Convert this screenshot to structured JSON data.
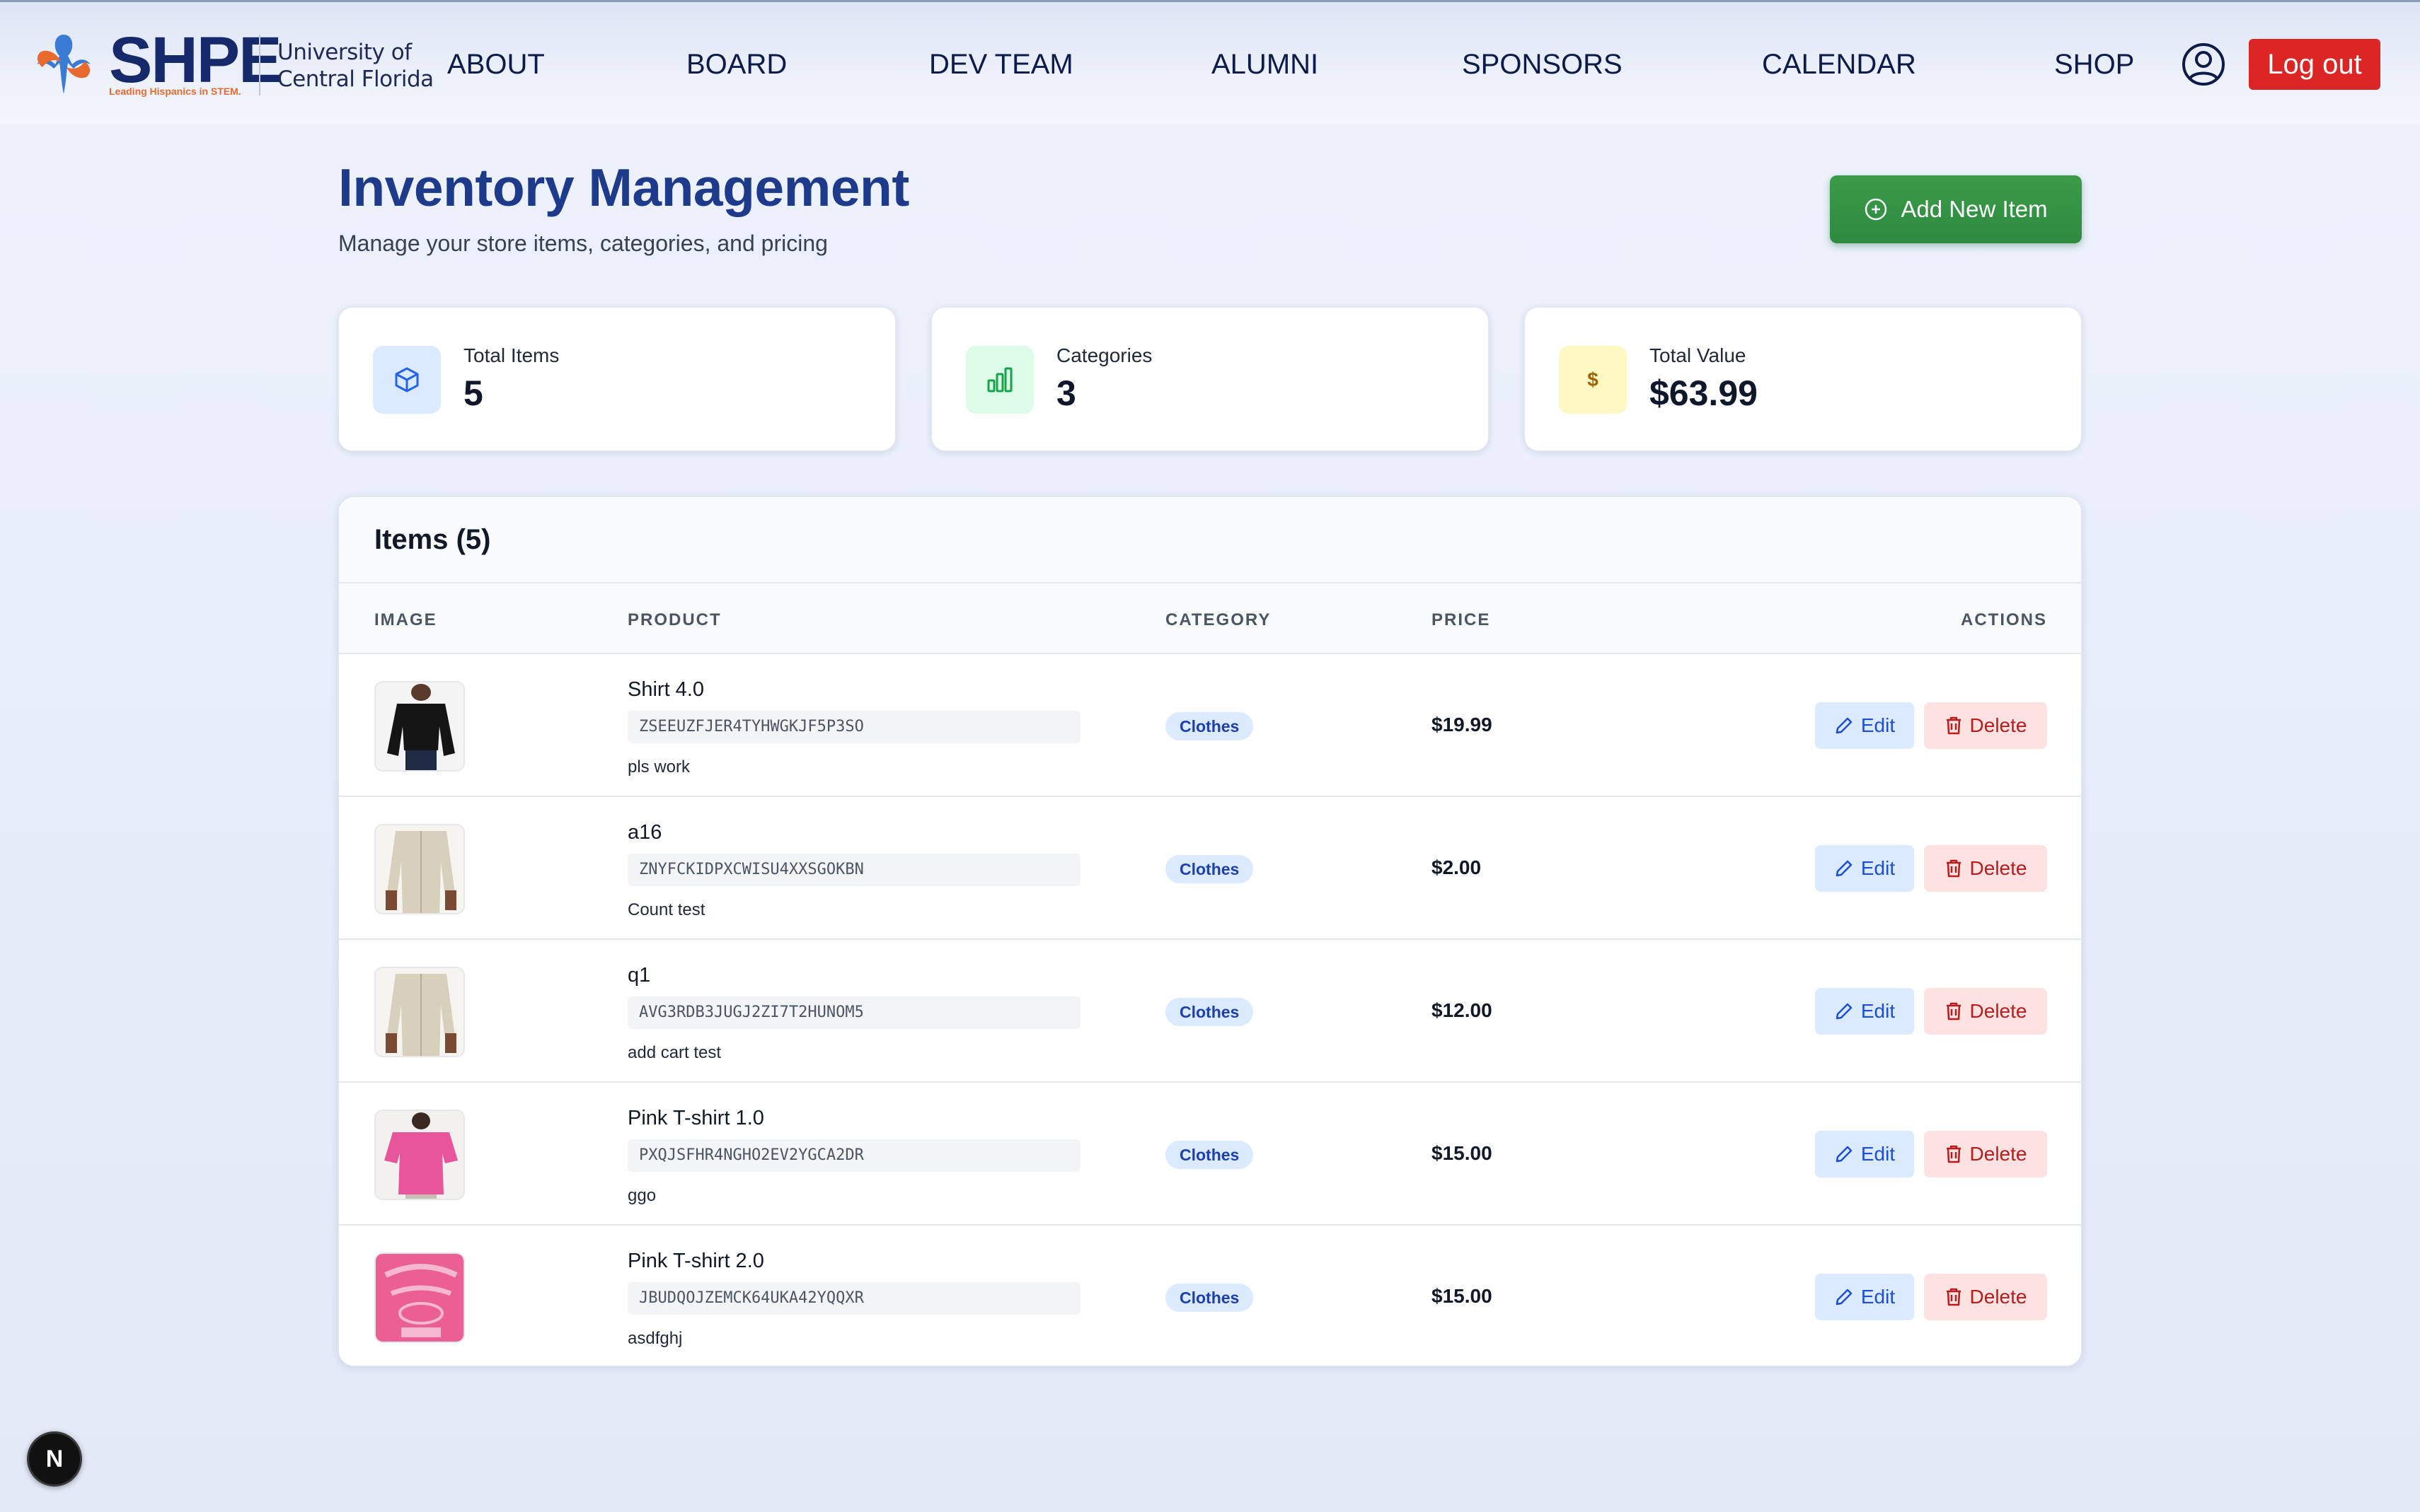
{
  "brand": {
    "name": "SHPE",
    "tagline": "Leading Hispanics in STEM.",
    "university": [
      "University of",
      "Central Florida"
    ],
    "colors": {
      "navy": "#15296b",
      "orange": "#e86a2e",
      "blue": "#3a7bd5"
    }
  },
  "nav": {
    "links": [
      "ABOUT",
      "BOARD",
      "DEV TEAM",
      "ALUMNI",
      "SPONSORS",
      "CALENDAR",
      "SHOP"
    ],
    "profile_icon": "user-circle-icon",
    "logout_label": "Log out"
  },
  "header": {
    "title": "Inventory Management",
    "subtitle": "Manage your store items, categories, and pricing",
    "add_button_label": "Add New Item",
    "add_button_icon": "plus-circle-icon"
  },
  "stats": [
    {
      "label": "Total Items",
      "value": "5",
      "icon": "cube-icon",
      "icon_bg": "#dbeafe",
      "icon_color": "#2563eb"
    },
    {
      "label": "Categories",
      "value": "3",
      "icon": "bar-chart-icon",
      "icon_bg": "#dcfce7",
      "icon_color": "#16a34a"
    },
    {
      "label": "Total Value",
      "value": "$63.99",
      "icon": "dollar-icon",
      "icon_bg": "#fef9c3",
      "icon_color": "#a16207"
    }
  ],
  "table": {
    "title": "Items (5)",
    "columns": [
      "IMAGE",
      "PRODUCT",
      "CATEGORY",
      "PRICE",
      "ACTIONS"
    ],
    "edit_label": "Edit",
    "delete_label": "Delete",
    "rows": [
      {
        "name": "Shirt 4.0",
        "code": "ZSEEUZFJER4TYHWGKJF5P3SO",
        "description": "pls work",
        "category": "Clothes",
        "price": "$19.99",
        "image": "black-blouse-photo"
      },
      {
        "name": "a16",
        "code": "ZNYFCKIDPXCWISU4XXSGOKBN",
        "description": "Count test",
        "category": "Clothes",
        "price": "$2.00",
        "image": "beige-shirt-photo"
      },
      {
        "name": "q1",
        "code": "AVG3RDB3JUGJ2ZI7T2HUNOM5",
        "description": "add cart test",
        "category": "Clothes",
        "price": "$12.00",
        "image": "beige-shirt-photo"
      },
      {
        "name": "Pink T-shirt 1.0",
        "code": "PXQJSFHR4NGHO2EV2YGCA2DR",
        "description": "ggo",
        "category": "Clothes",
        "price": "$15.00",
        "image": "pink-tshirt-photo"
      },
      {
        "name": "Pink T-shirt 2.0",
        "code": "JBUDQOJZEMCK64UKA42YQQXR",
        "description": "asdfghj",
        "category": "Clothes",
        "price": "$15.00",
        "image": "pink-graphic-tshirt-photo"
      }
    ]
  },
  "dev_badge": {
    "letter": "N"
  }
}
